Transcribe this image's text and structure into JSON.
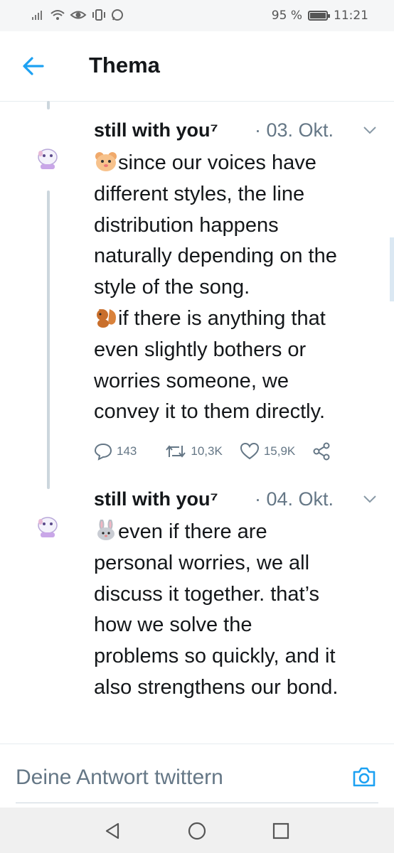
{
  "status_bar": {
    "left_icons": [
      "signal-icon",
      "wifi-icon",
      "eye-icon",
      "vibrate-icon",
      "whatsapp-icon"
    ],
    "battery_percent": "95 %",
    "time": "11:21"
  },
  "header": {
    "title": "Thema"
  },
  "tweets": [
    {
      "author": "still with you⁷",
      "date": "· 03. Okt.",
      "lines": [
        "since our voices have",
        "different styles, the line",
        "distribution happens",
        "naturally depending on the",
        "style of the song.",
        "if there is anything that",
        "even slightly bothers or",
        "worries someone, we",
        "convey it to them directly."
      ],
      "replies": "143",
      "retweets": "10,3K",
      "likes": "15,9K"
    },
    {
      "author": "still with you⁷",
      "date": "· 04. Okt.",
      "lines": [
        "even if there are",
        "personal worries, we all",
        "discuss it together. that’s",
        "how we solve the",
        "problems so quickly, and it",
        "also strengthens our bond."
      ]
    }
  ],
  "reply_bar": {
    "placeholder": "Deine Antwort twittern"
  },
  "colors": {
    "accent": "#1da1f2",
    "text": "#14171a",
    "muted": "#657786"
  }
}
